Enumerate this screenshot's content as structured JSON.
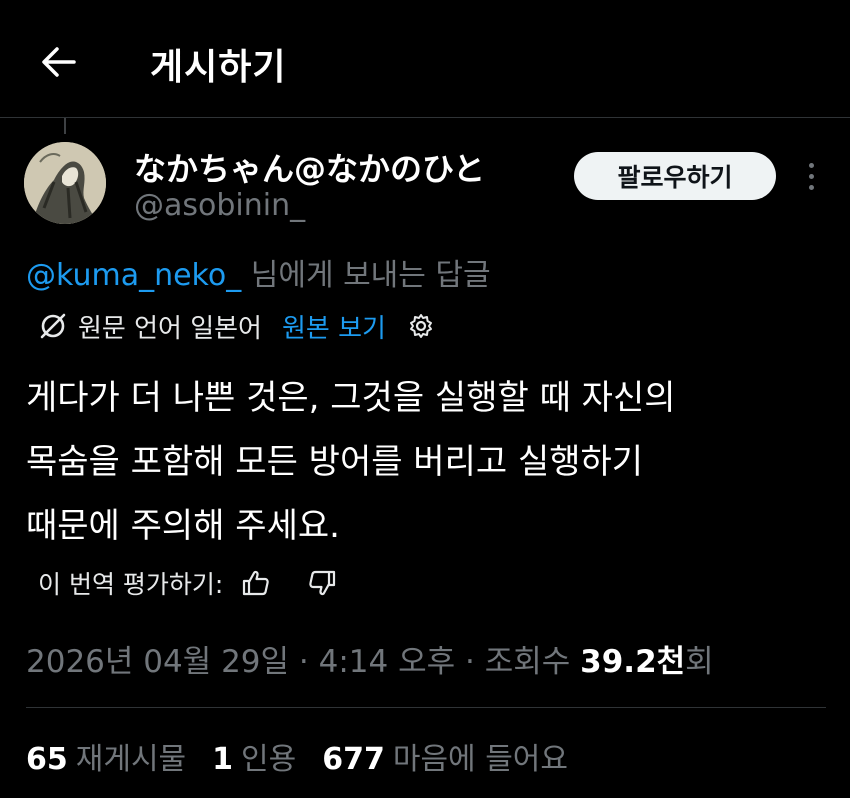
{
  "header": {
    "title": "게시하기",
    "back_icon": "arrow-left-icon"
  },
  "author": {
    "display_name": "なかちゃん@なかのひと",
    "handle": "@asobinin_",
    "follow_label": "팔로우하기",
    "more_icon": "more-vertical-icon"
  },
  "reply": {
    "mention": "@kuma_neko_",
    "suffix": "님에게 보내는 답글"
  },
  "translation": {
    "icon": "translate-icon",
    "language_label": "원문 언어 일본어",
    "show_original": "원본 보기",
    "settings_icon": "gear-icon"
  },
  "tweet": {
    "lines": [
      "게다가 더 나쁜 것은, 그것을 실행할 때 자신의",
      "목숨을 포함해 모든 방어를 버리고 실행하기",
      "때문에 주의해 주세요."
    ]
  },
  "rating": {
    "label": "이 번역 평가하기:",
    "like_icon": "thumbs-up-icon",
    "dislike_icon": "thumbs-down-icon"
  },
  "meta": {
    "date": "2026년 04월 29일",
    "separator": "·",
    "time": "4:14 오후",
    "views_prefix": "조회수",
    "views_number": "39.2천",
    "views_suffix": "회"
  },
  "stats": {
    "reposts_count": "65",
    "reposts_label": "재게시물",
    "quotes_count": "1",
    "quotes_label": "인용",
    "likes_count": "677",
    "likes_label": "마음에 들어요"
  },
  "colors": {
    "background": "#000000",
    "link": "#1d9bf0",
    "muted": "#71767b",
    "follow_button_bg": "#eff3f4"
  }
}
